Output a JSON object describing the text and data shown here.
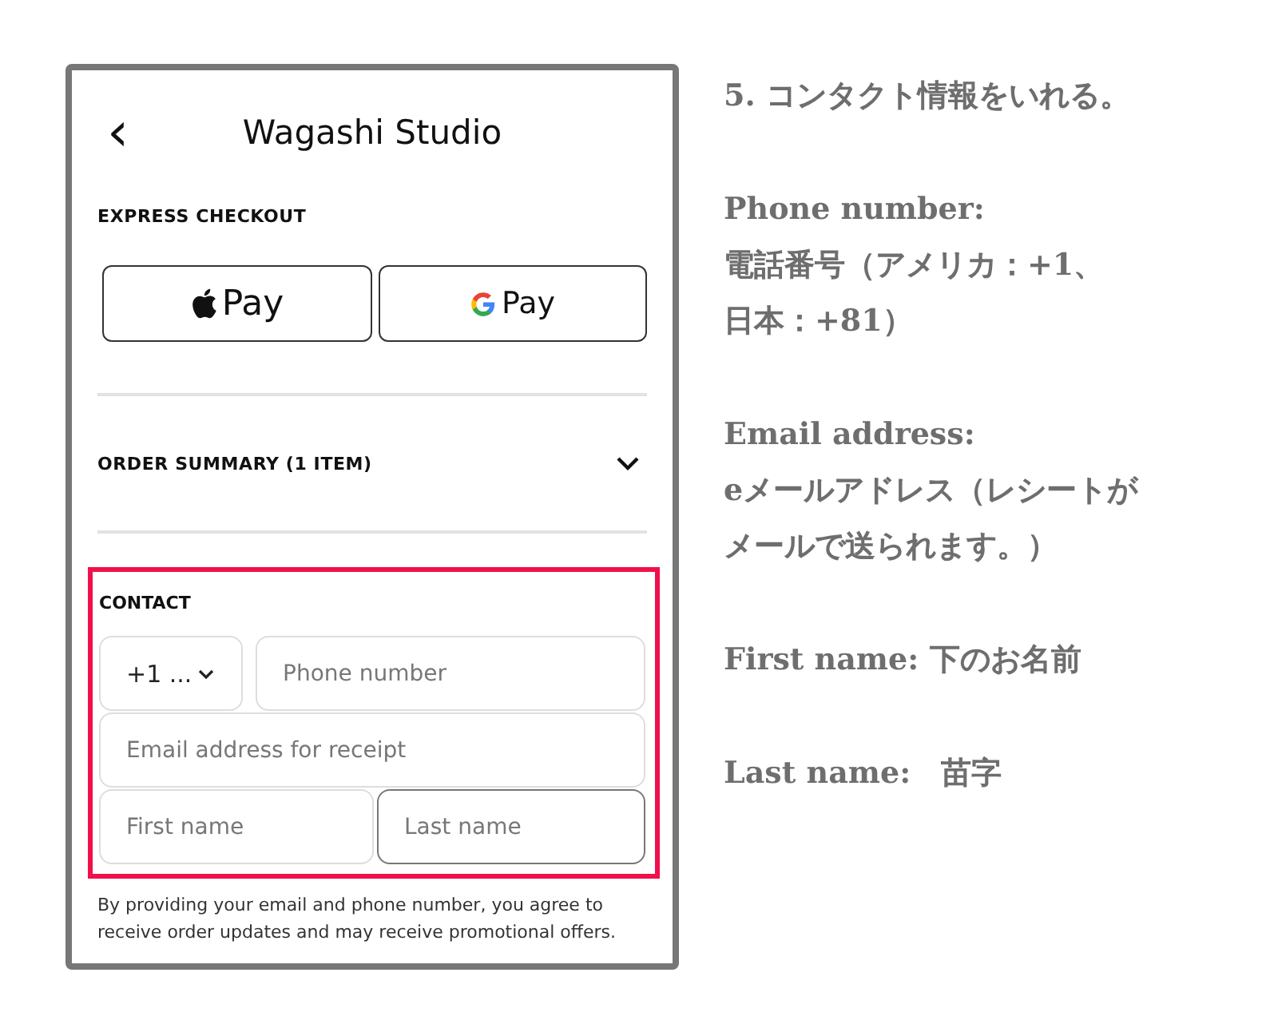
{
  "phone": {
    "back": "‹",
    "title": "Wagashi Studio",
    "express_checkout": {
      "heading": "EXPRESS CHECKOUT",
      "buttons": [
        {
          "kind": "apple",
          "label": "Pay"
        },
        {
          "kind": "google",
          "label": "Pay"
        }
      ]
    },
    "order_summary": {
      "label": "ORDER SUMMARY (1 ITEM)",
      "expanded": false
    },
    "contact": {
      "heading": "CONTACT",
      "highlighted": true,
      "country_code": {
        "value": "+1 ..."
      },
      "fields": [
        {
          "kind": "phone",
          "placeholder": "Phone number",
          "focused": false
        },
        {
          "kind": "email",
          "placeholder": "Email address for receipt",
          "focused": false
        },
        {
          "kind": "first",
          "placeholder": "First name",
          "focused": false
        },
        {
          "kind": "last",
          "placeholder": "Last name",
          "focused": true
        }
      ]
    },
    "disclaimer": "By providing your email and phone number, you agree to receive order updates and may receive promotional offers."
  },
  "notes": [
    {
      "lines": [
        "5. コンタクト情報をいれる。"
      ]
    },
    {
      "lines": [
        "Phone number:",
        "電話番号（アメリカ：+1、",
        "日本：+81）"
      ]
    },
    {
      "lines": [
        "Email address:",
        "eメールアドレス（レシートが",
        "メールで送られます。）"
      ]
    },
    {
      "lines": [
        "First name: 下のお名前"
      ]
    },
    {
      "lines": [
        "Last name:　苗字"
      ]
    }
  ]
}
